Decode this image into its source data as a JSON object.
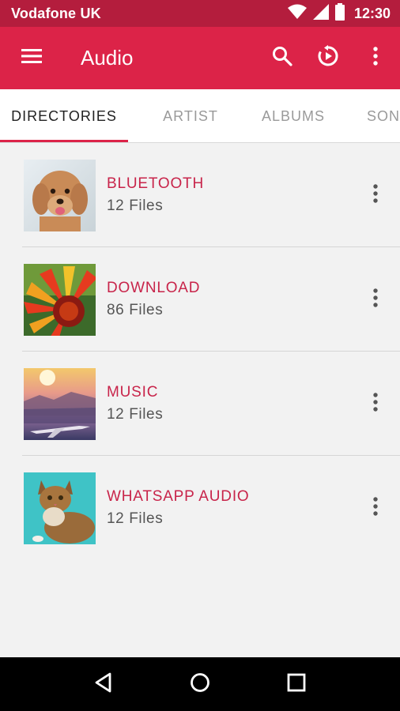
{
  "status_bar": {
    "carrier": "Vodafone UK",
    "time": "12:30",
    "icons": [
      "wifi-icon",
      "signal-icon",
      "battery-icon"
    ]
  },
  "app_bar": {
    "title": "Audio",
    "actions": [
      "menu-icon",
      "search-icon",
      "refresh-play-icon",
      "more-vert-icon"
    ]
  },
  "tabs": [
    {
      "label": "DIRECTORIES",
      "active": true
    },
    {
      "label": "ARTIST",
      "active": false
    },
    {
      "label": "ALBUMS",
      "active": false
    },
    {
      "label": "SON",
      "active": false
    }
  ],
  "folders": [
    {
      "name": "BLUETOOTH",
      "count": "12 Files",
      "thumbnail": "dog-photo"
    },
    {
      "name": "DOWNLOAD",
      "count": "86 Files",
      "thumbnail": "flower-photo"
    },
    {
      "name": "MUSIC",
      "count": "12 Files",
      "thumbnail": "airplane-sunset-photo"
    },
    {
      "name": "WHATSAPP AUDIO",
      "count": "12 Files",
      "thumbnail": "cat-photo"
    }
  ],
  "nav_bar": {
    "buttons": [
      "back-icon",
      "home-icon",
      "recents-icon"
    ]
  },
  "colors": {
    "status_bar": "#b41d3d",
    "app_bar": "#dc2348",
    "accent": "#c8244a",
    "background": "#f2f2f2"
  }
}
